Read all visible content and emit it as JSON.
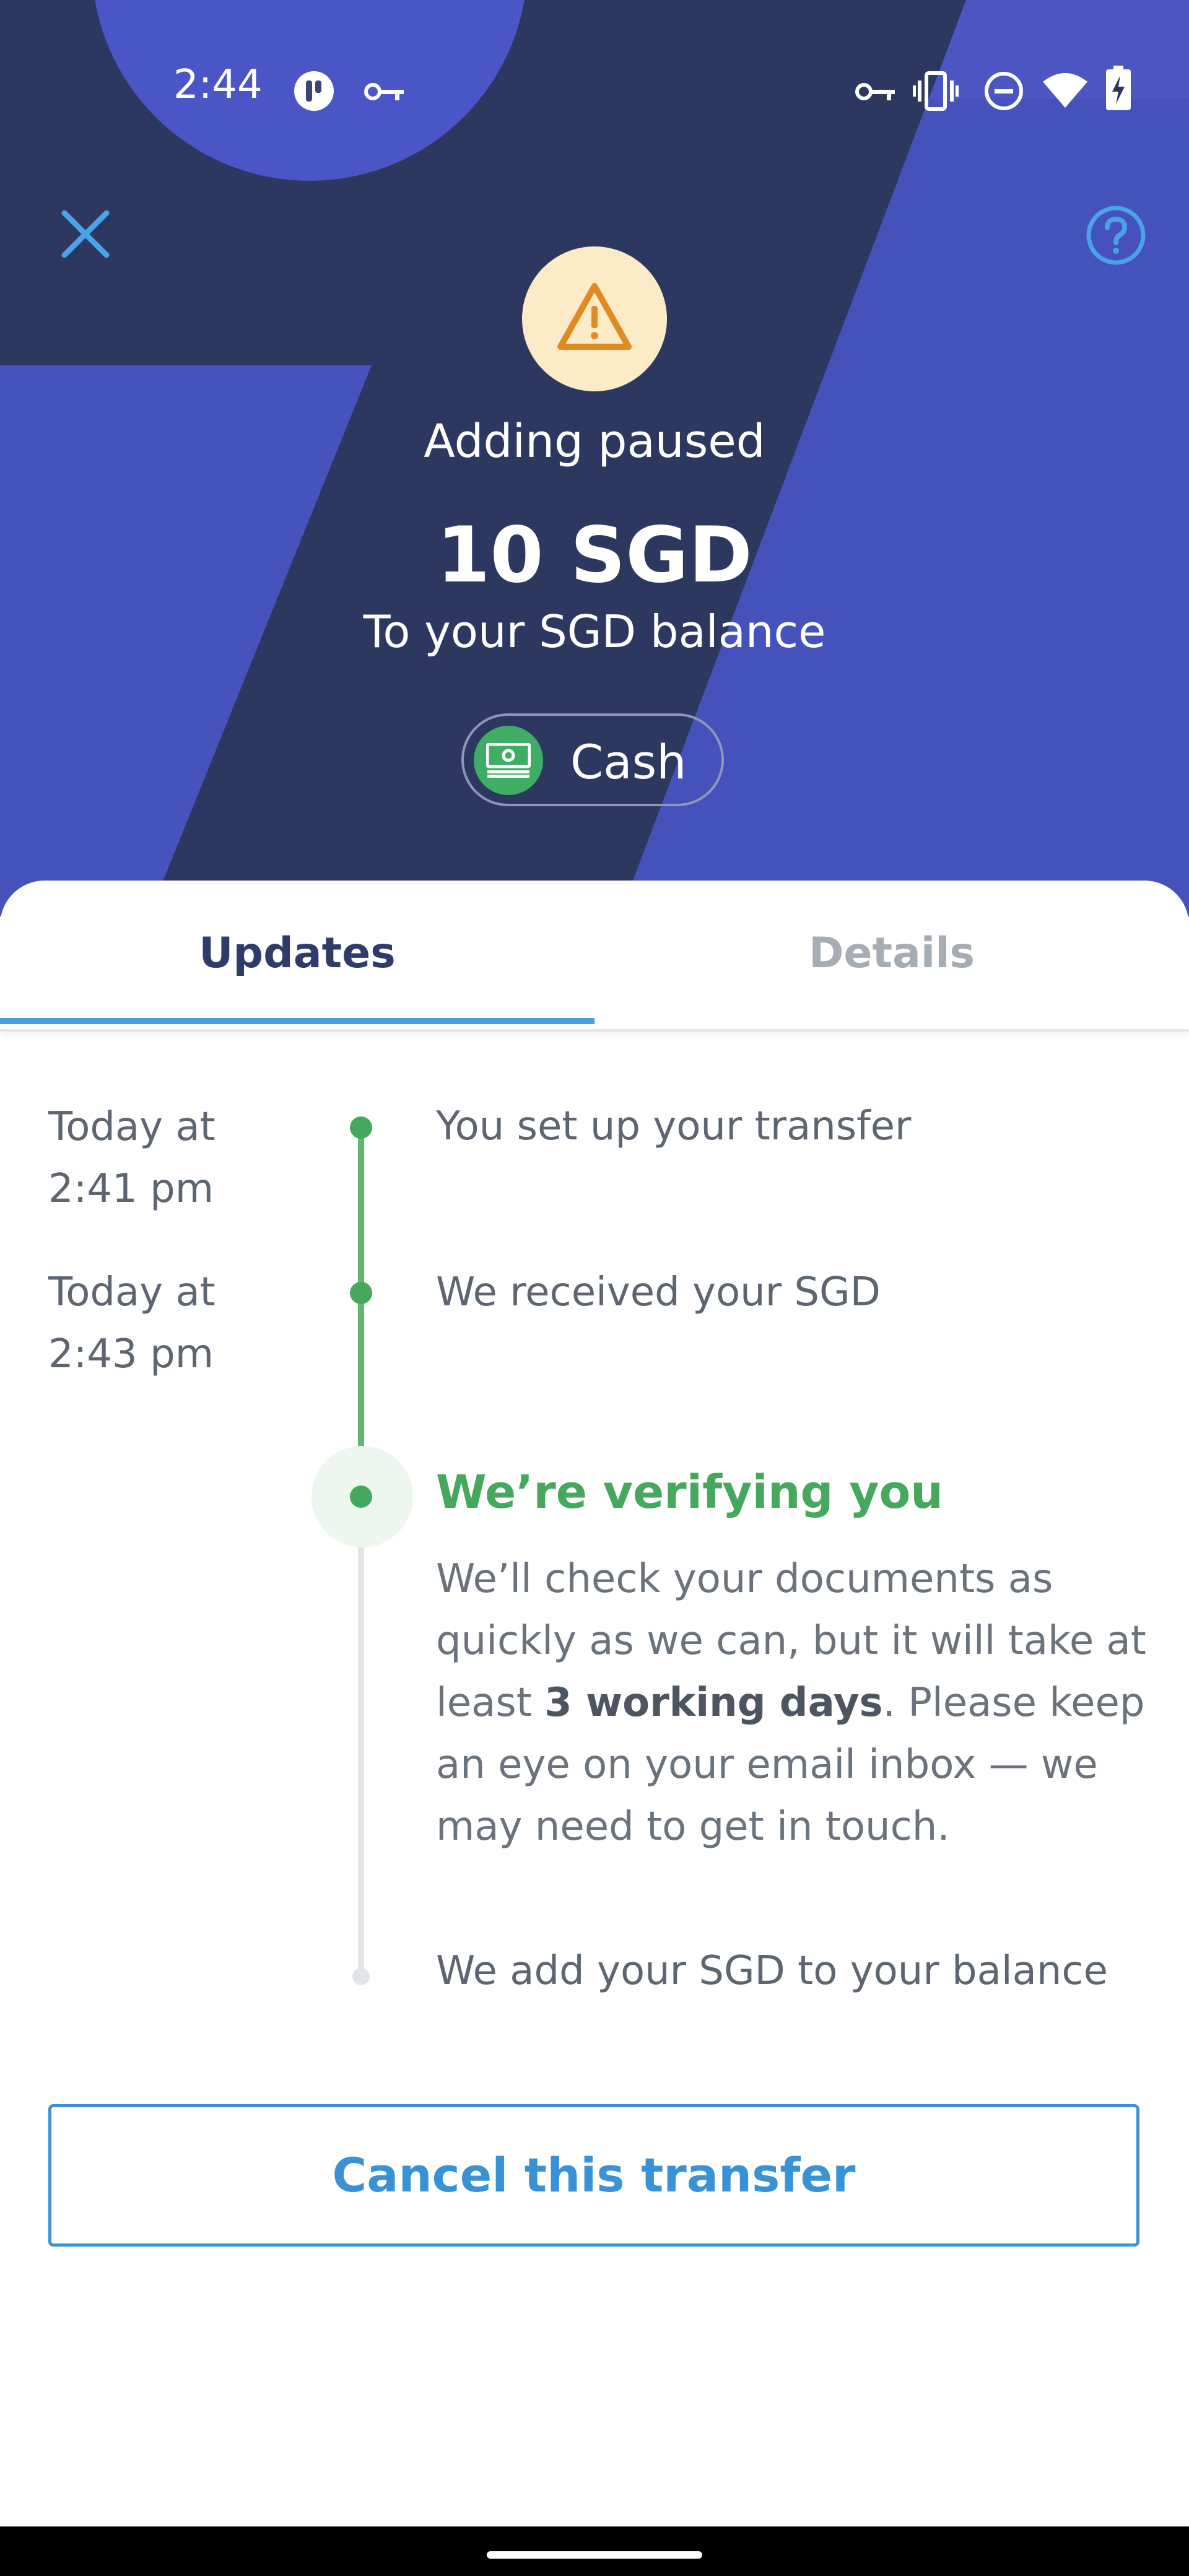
{
  "status_bar": {
    "time": "2:44",
    "left_icons": [
      "app-notification-icon",
      "vpn-key-icon"
    ],
    "right_icons": [
      "vpn-key-icon",
      "vibrate-icon",
      "do-not-disturb-icon",
      "wifi-icon",
      "battery-charging-icon"
    ]
  },
  "header": {
    "close_icon": "close-icon",
    "help_icon": "help-circle-icon",
    "status_icon": "warning-triangle-icon",
    "status": "Adding paused",
    "amount": "10 SGD",
    "destination": "To your SGD balance",
    "method": {
      "icon": "cash-icon",
      "label": "Cash"
    }
  },
  "tabs": [
    {
      "label": "Updates",
      "active": true
    },
    {
      "label": "Details",
      "active": false
    }
  ],
  "timeline": {
    "steps": [
      {
        "time": "Today at\n2:41 pm",
        "text": "You set up your transfer",
        "state": "done"
      },
      {
        "time": "Today at\n2:43 pm",
        "text": "We received your SGD",
        "state": "done"
      },
      {
        "title": "We’re verifying you",
        "state": "current",
        "desc_before": "We’ll check your documents as quickly as we can, but it will take at least ",
        "desc_bold": "3 working days",
        "desc_after": ". Please keep an eye on your email inbox — we may need to get in touch."
      },
      {
        "text": "We add your SGD to your balance",
        "state": "pending"
      }
    ]
  },
  "actions": {
    "cancel_label": "Cancel this transfer"
  },
  "colors": {
    "hero_dark": "#29355a",
    "hero_blue": "#4753bd",
    "accent_blue": "#3a92d6",
    "success_green": "#45a85c",
    "warning_bg": "#fdebc8",
    "warning_icon": "#e08a22",
    "text_gray": "#5d6670"
  }
}
